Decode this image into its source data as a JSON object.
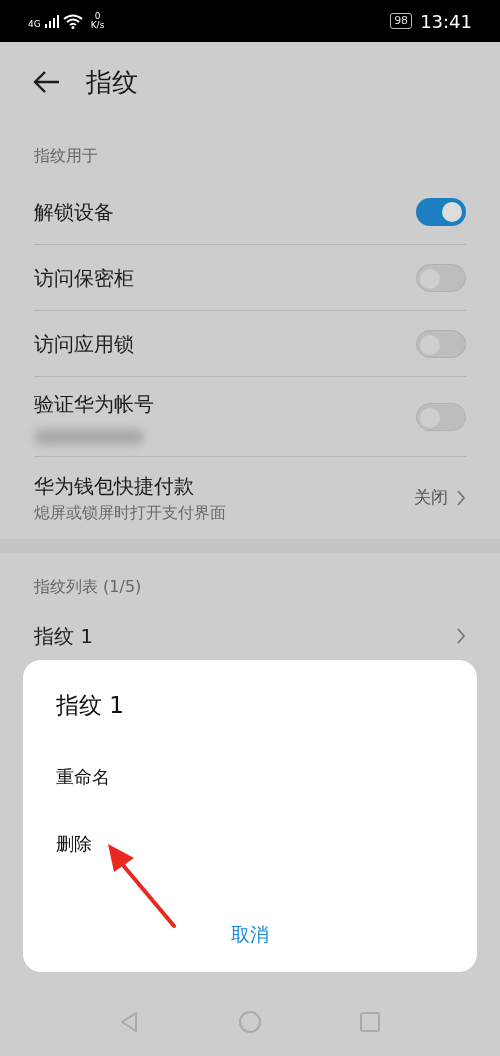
{
  "status_bar": {
    "network": "4G",
    "speed_value": "0",
    "speed_unit": "K/s",
    "battery": "98",
    "time": "13:41"
  },
  "header": {
    "title": "指纹"
  },
  "usage_section": {
    "title": "指纹用于",
    "items": [
      {
        "kind": "toggle",
        "label": "解锁设备",
        "on": true
      },
      {
        "kind": "toggle",
        "label": "访问保密柜",
        "on": false
      },
      {
        "kind": "toggle",
        "label": "访问应用锁",
        "on": false
      },
      {
        "kind": "toggle",
        "label": "验证华为帐号",
        "on": false,
        "redacted_subtitle": true
      },
      {
        "kind": "link",
        "label": "华为钱包快捷付款",
        "subtitle": "熄屏或锁屏时打开支付界面",
        "value": "关闭"
      }
    ]
  },
  "fingerprint_section": {
    "title": "指纹列表 (1/5)",
    "items": [
      {
        "label": "指纹 1"
      }
    ]
  },
  "dialog": {
    "title": "指纹 1",
    "options": [
      {
        "label": "重命名"
      },
      {
        "label": "删除"
      }
    ],
    "cancel": "取消"
  }
}
